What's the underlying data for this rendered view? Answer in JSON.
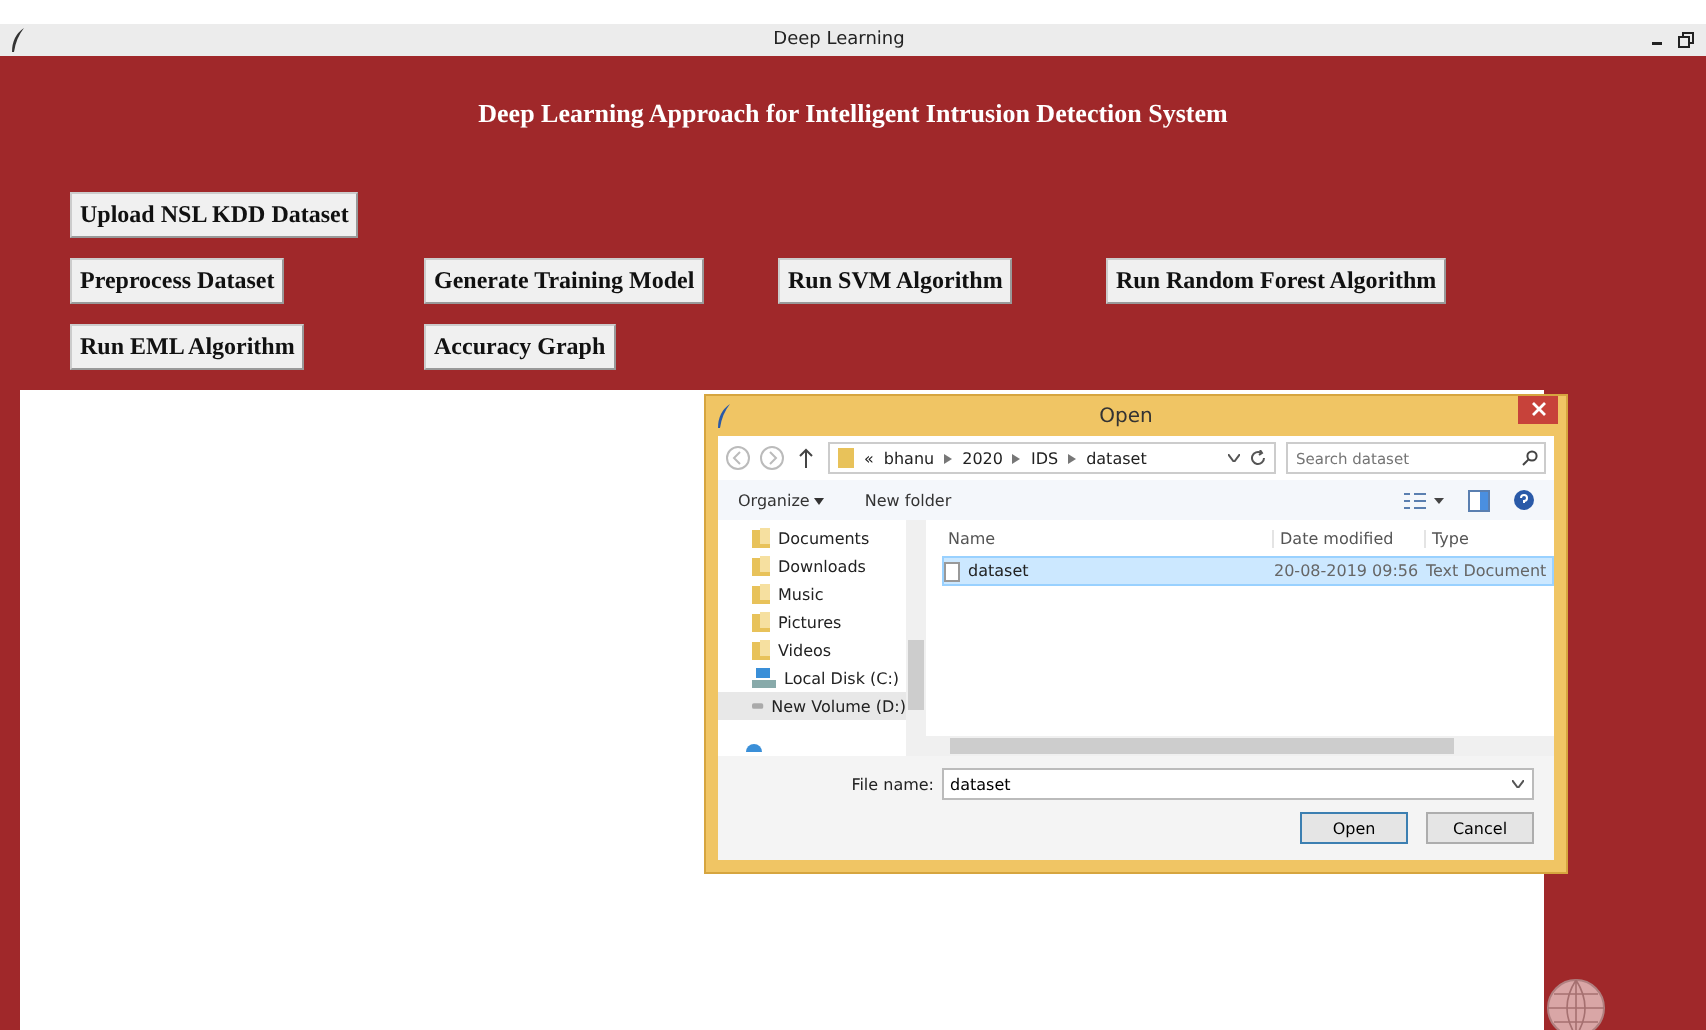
{
  "window": {
    "title": "Deep Learning"
  },
  "heading": "Deep Learning Approach for Intelligent Intrusion Detection System",
  "button_rows": [
    [
      "Upload NSL KDD Dataset"
    ],
    [
      "Preprocess Dataset",
      "Generate Training Model",
      "Run SVM Algorithm",
      "Run Random Forest Algorithm"
    ],
    [
      "Run EML Algorithm",
      "Accuracy Graph"
    ]
  ],
  "dialog": {
    "title": "Open",
    "breadcrumb": [
      "«",
      "bhanu",
      "2020",
      "IDS",
      "dataset"
    ],
    "search": {
      "placeholder": "Search dataset"
    },
    "toolbar": [
      "Organize",
      "New folder"
    ],
    "sidebar": [
      {
        "label": "Documents",
        "kind": "folder",
        "selected": false
      },
      {
        "label": "Downloads",
        "kind": "folder",
        "selected": false
      },
      {
        "label": "Music",
        "kind": "folder",
        "selected": false
      },
      {
        "label": "Pictures",
        "kind": "folder",
        "selected": false
      },
      {
        "label": "Videos",
        "kind": "folder",
        "selected": false
      },
      {
        "label": "Local Disk (C:)",
        "kind": "disk",
        "selected": false
      },
      {
        "label": "New Volume (D:)",
        "kind": "drive",
        "selected": true
      }
    ],
    "columns": [
      "Name",
      "Date modified",
      "Type"
    ],
    "files": [
      {
        "name": "dataset",
        "date": "20-08-2019 09:56",
        "type": "Text Document",
        "selected": true
      }
    ],
    "file_name_label": "File name:",
    "file_name": "dataset",
    "buttons": [
      "Open",
      "Cancel"
    ]
  }
}
